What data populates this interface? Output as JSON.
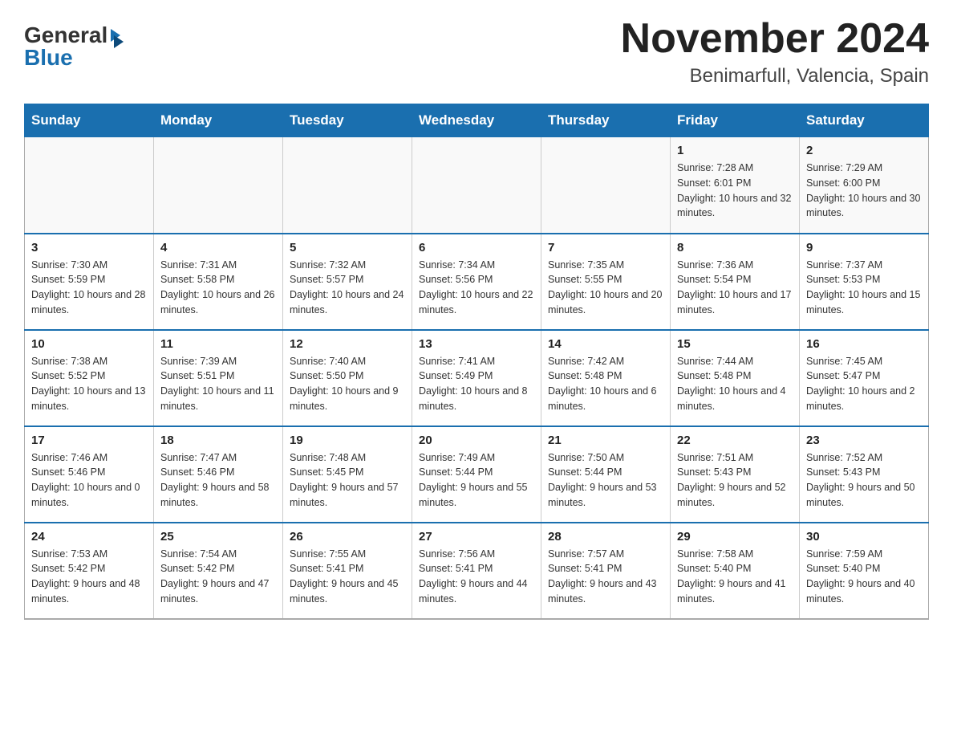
{
  "header": {
    "title": "November 2024",
    "location": "Benimarfull, Valencia, Spain",
    "logo_general": "General",
    "logo_blue": "Blue"
  },
  "days_of_week": [
    "Sunday",
    "Monday",
    "Tuesday",
    "Wednesday",
    "Thursday",
    "Friday",
    "Saturday"
  ],
  "weeks": [
    [
      {
        "day": "",
        "info": ""
      },
      {
        "day": "",
        "info": ""
      },
      {
        "day": "",
        "info": ""
      },
      {
        "day": "",
        "info": ""
      },
      {
        "day": "",
        "info": ""
      },
      {
        "day": "1",
        "info": "Sunrise: 7:28 AM\nSunset: 6:01 PM\nDaylight: 10 hours and 32 minutes."
      },
      {
        "day": "2",
        "info": "Sunrise: 7:29 AM\nSunset: 6:00 PM\nDaylight: 10 hours and 30 minutes."
      }
    ],
    [
      {
        "day": "3",
        "info": "Sunrise: 7:30 AM\nSunset: 5:59 PM\nDaylight: 10 hours and 28 minutes."
      },
      {
        "day": "4",
        "info": "Sunrise: 7:31 AM\nSunset: 5:58 PM\nDaylight: 10 hours and 26 minutes."
      },
      {
        "day": "5",
        "info": "Sunrise: 7:32 AM\nSunset: 5:57 PM\nDaylight: 10 hours and 24 minutes."
      },
      {
        "day": "6",
        "info": "Sunrise: 7:34 AM\nSunset: 5:56 PM\nDaylight: 10 hours and 22 minutes."
      },
      {
        "day": "7",
        "info": "Sunrise: 7:35 AM\nSunset: 5:55 PM\nDaylight: 10 hours and 20 minutes."
      },
      {
        "day": "8",
        "info": "Sunrise: 7:36 AM\nSunset: 5:54 PM\nDaylight: 10 hours and 17 minutes."
      },
      {
        "day": "9",
        "info": "Sunrise: 7:37 AM\nSunset: 5:53 PM\nDaylight: 10 hours and 15 minutes."
      }
    ],
    [
      {
        "day": "10",
        "info": "Sunrise: 7:38 AM\nSunset: 5:52 PM\nDaylight: 10 hours and 13 minutes."
      },
      {
        "day": "11",
        "info": "Sunrise: 7:39 AM\nSunset: 5:51 PM\nDaylight: 10 hours and 11 minutes."
      },
      {
        "day": "12",
        "info": "Sunrise: 7:40 AM\nSunset: 5:50 PM\nDaylight: 10 hours and 9 minutes."
      },
      {
        "day": "13",
        "info": "Sunrise: 7:41 AM\nSunset: 5:49 PM\nDaylight: 10 hours and 8 minutes."
      },
      {
        "day": "14",
        "info": "Sunrise: 7:42 AM\nSunset: 5:48 PM\nDaylight: 10 hours and 6 minutes."
      },
      {
        "day": "15",
        "info": "Sunrise: 7:44 AM\nSunset: 5:48 PM\nDaylight: 10 hours and 4 minutes."
      },
      {
        "day": "16",
        "info": "Sunrise: 7:45 AM\nSunset: 5:47 PM\nDaylight: 10 hours and 2 minutes."
      }
    ],
    [
      {
        "day": "17",
        "info": "Sunrise: 7:46 AM\nSunset: 5:46 PM\nDaylight: 10 hours and 0 minutes."
      },
      {
        "day": "18",
        "info": "Sunrise: 7:47 AM\nSunset: 5:46 PM\nDaylight: 9 hours and 58 minutes."
      },
      {
        "day": "19",
        "info": "Sunrise: 7:48 AM\nSunset: 5:45 PM\nDaylight: 9 hours and 57 minutes."
      },
      {
        "day": "20",
        "info": "Sunrise: 7:49 AM\nSunset: 5:44 PM\nDaylight: 9 hours and 55 minutes."
      },
      {
        "day": "21",
        "info": "Sunrise: 7:50 AM\nSunset: 5:44 PM\nDaylight: 9 hours and 53 minutes."
      },
      {
        "day": "22",
        "info": "Sunrise: 7:51 AM\nSunset: 5:43 PM\nDaylight: 9 hours and 52 minutes."
      },
      {
        "day": "23",
        "info": "Sunrise: 7:52 AM\nSunset: 5:43 PM\nDaylight: 9 hours and 50 minutes."
      }
    ],
    [
      {
        "day": "24",
        "info": "Sunrise: 7:53 AM\nSunset: 5:42 PM\nDaylight: 9 hours and 48 minutes."
      },
      {
        "day": "25",
        "info": "Sunrise: 7:54 AM\nSunset: 5:42 PM\nDaylight: 9 hours and 47 minutes."
      },
      {
        "day": "26",
        "info": "Sunrise: 7:55 AM\nSunset: 5:41 PM\nDaylight: 9 hours and 45 minutes."
      },
      {
        "day": "27",
        "info": "Sunrise: 7:56 AM\nSunset: 5:41 PM\nDaylight: 9 hours and 44 minutes."
      },
      {
        "day": "28",
        "info": "Sunrise: 7:57 AM\nSunset: 5:41 PM\nDaylight: 9 hours and 43 minutes."
      },
      {
        "day": "29",
        "info": "Sunrise: 7:58 AM\nSunset: 5:40 PM\nDaylight: 9 hours and 41 minutes."
      },
      {
        "day": "30",
        "info": "Sunrise: 7:59 AM\nSunset: 5:40 PM\nDaylight: 9 hours and 40 minutes."
      }
    ]
  ]
}
